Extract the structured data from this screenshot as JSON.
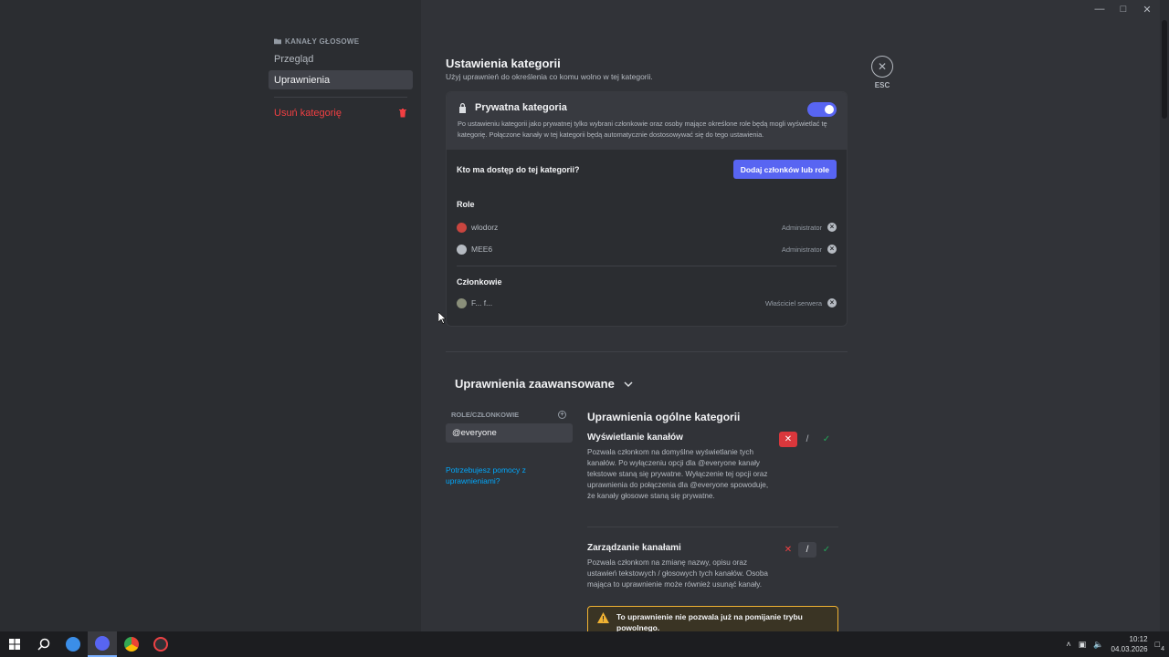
{
  "nav": {
    "header": "KANAŁY GŁOSOWE",
    "items": [
      {
        "label": "Przegląd"
      },
      {
        "label": "Uprawnienia"
      }
    ],
    "delete_label": "Usuń kategorię"
  },
  "page": {
    "title": "Ustawienia kategorii",
    "subtitle": "Użyj uprawnień do określenia co komu wolno w tej kategorii.",
    "esc_label": "ESC"
  },
  "private": {
    "title": "Prywatna kategoria",
    "enabled": true,
    "description": "Po ustawieniu kategorii jako prywatnej tylko wybrani członkowie oraz osoby mające określone role będą mogli wyświetlać tę kategorię. Połączone kanały w tej kategorii będą automatycznie dostosowywać się do tego ustawienia."
  },
  "access": {
    "question": "Kto ma dostęp do tej kategorii?",
    "add_button": "Dodaj członków lub role",
    "roles_label": "Role",
    "roles": [
      {
        "name": "wlodorz",
        "tag": "Administrator",
        "color": "#c9453f"
      },
      {
        "name": "MEE6",
        "tag": "Administrator",
        "color": "#b5bac1"
      }
    ],
    "members_label": "Członkowie",
    "members": [
      {
        "name": "F... f...",
        "tag": "Właściciel serwera"
      }
    ]
  },
  "advanced": {
    "title": "Uprawnienia zaawansowane",
    "roles_header": "ROLE/CZŁONKOWIE",
    "selected_role": "@everyone",
    "help_link": "Potrzebujesz pomocy z uprawnieniami?",
    "section_title": "Uprawnienia ogólne kategorii",
    "permissions": [
      {
        "name": "Wyświetlanie kanałów",
        "description": "Pozwala członkom na domyślne wyświetlanie tych kanałów. Po wyłączeniu opcji dla @everyone kanały tekstowe staną się prywatne. Wyłączenie tej opcji oraz uprawnienia do połączenia dla @everyone spowoduje, że kanały głosowe staną się prywatne.",
        "state": "deny"
      },
      {
        "name": "Zarządzanie kanałami",
        "description": "Pozwala członkom na zmianę nazwy, opisu oraz ustawień tekstowych / głosowych tych kanałów. Osoba mająca to uprawnienie może również usunąć kanały.",
        "state": "neutral"
      }
    ],
    "warning": "To uprawnienie nie pozwala już na pomijanie trybu powolnego."
  },
  "taskbar": {
    "time": "10:12",
    "date": "04.03.2026",
    "notifications": "4"
  },
  "colors": {
    "accent": "#5865f2",
    "danger": "#f23f42",
    "success": "#23a559",
    "warning": "#f0b232"
  }
}
